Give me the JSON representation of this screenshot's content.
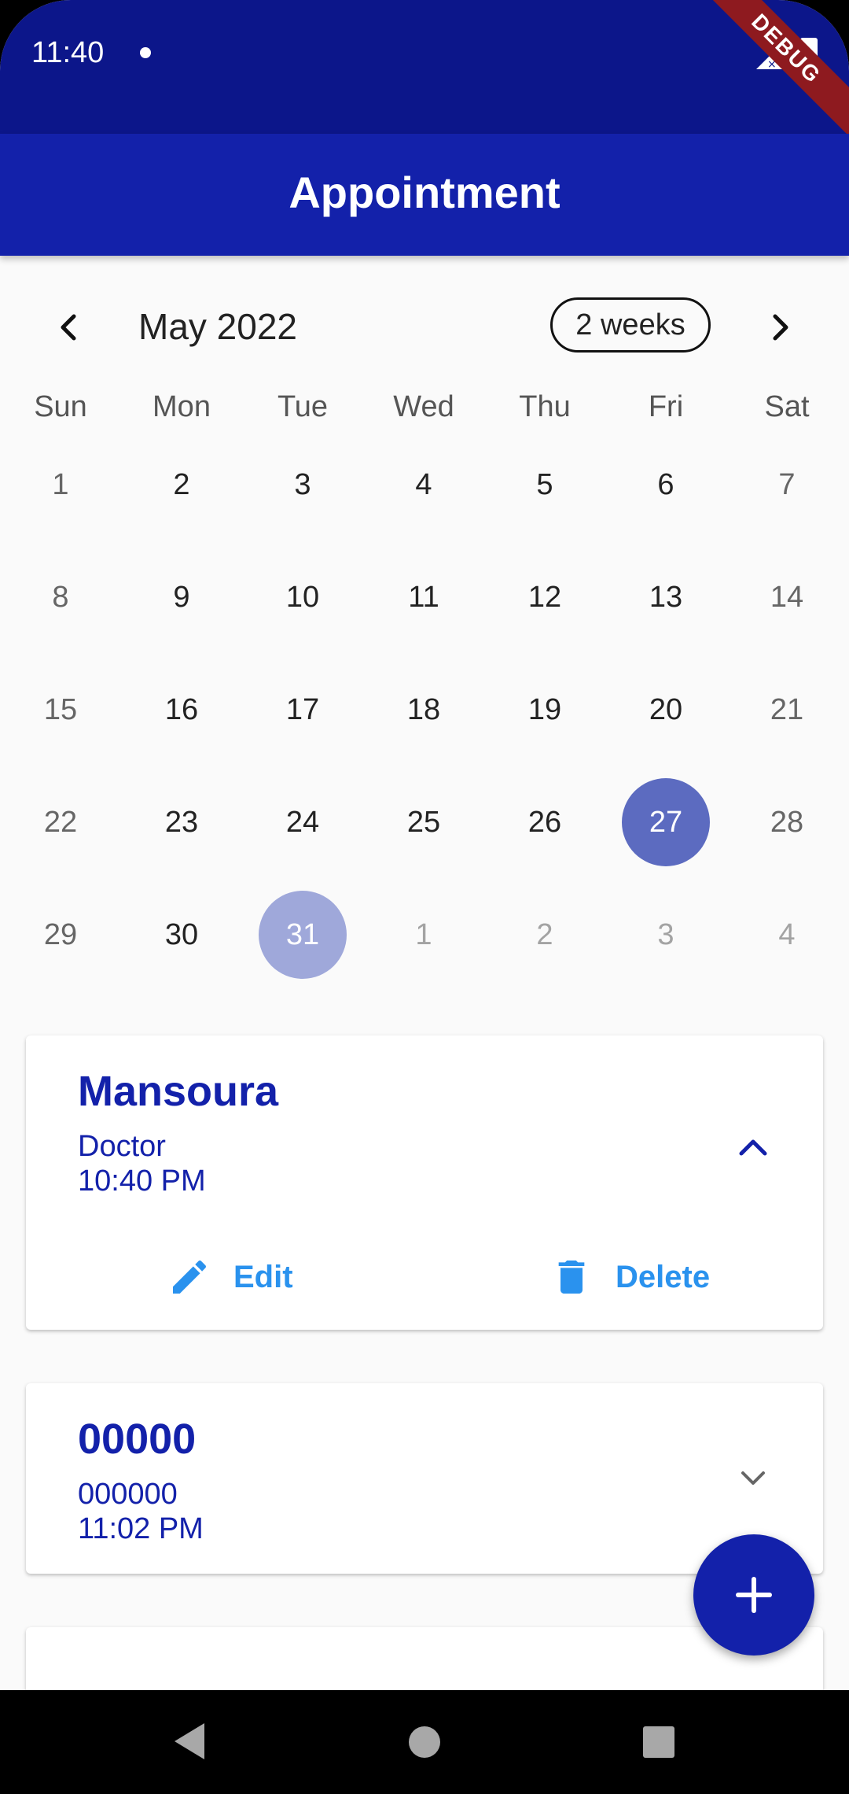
{
  "status_bar": {
    "time": "11:40",
    "debug_banner": "DEBUG"
  },
  "app_bar": {
    "title": "Appointment"
  },
  "calendar": {
    "month_label": "May 2022",
    "format_button": "2 weeks",
    "weekdays": [
      "Sun",
      "Mon",
      "Tue",
      "Wed",
      "Thu",
      "Fri",
      "Sat"
    ],
    "weeks": [
      [
        "1",
        "2",
        "3",
        "4",
        "5",
        "6",
        "7"
      ],
      [
        "8",
        "9",
        "10",
        "11",
        "12",
        "13",
        "14"
      ],
      [
        "15",
        "16",
        "17",
        "18",
        "19",
        "20",
        "21"
      ],
      [
        "22",
        "23",
        "24",
        "25",
        "26",
        "27",
        "28"
      ],
      [
        "29",
        "30",
        "31",
        "1",
        "2",
        "3",
        "4"
      ]
    ],
    "selected_day": "27",
    "today": "31",
    "colors": {
      "selected": "#5c6bc0",
      "today": "#9fa8da"
    }
  },
  "appointments": [
    {
      "title": "Mansoura",
      "subtitle": "Doctor",
      "time": "10:40 PM",
      "expanded": true,
      "edit_label": "Edit",
      "delete_label": "Delete"
    },
    {
      "title": "00000",
      "subtitle": "000000",
      "time": "11:02 PM",
      "expanded": false
    }
  ],
  "fab": {
    "icon": "plus-icon"
  },
  "colors": {
    "primary": "#1321aa",
    "status_bar": "#0c168a",
    "action": "#2a92ee"
  }
}
